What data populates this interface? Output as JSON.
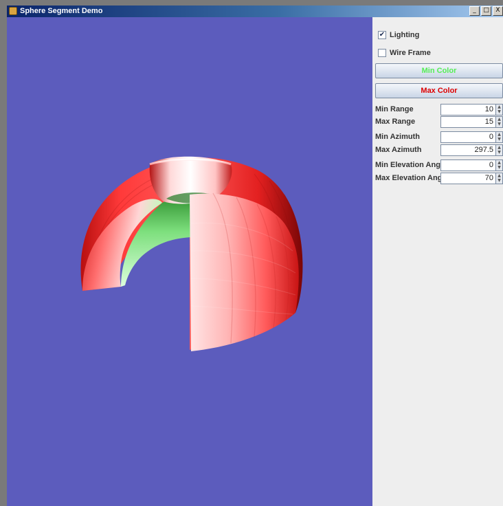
{
  "window": {
    "title": "Sphere Segment Demo"
  },
  "window_buttons": {
    "minimize": "_",
    "maximize": "□",
    "close": "X"
  },
  "controls": {
    "lighting": {
      "label": "Lighting",
      "checked": true,
      "mark": "✔"
    },
    "wireframe": {
      "label": "Wire Frame",
      "checked": false,
      "mark": ""
    },
    "min_color": {
      "label": "Min Color",
      "color": "#55ee55"
    },
    "max_color": {
      "label": "Max Color",
      "color": "#dd0000"
    }
  },
  "fields": [
    {
      "label": "Min Range",
      "value": "10"
    },
    {
      "label": "Max Range",
      "value": "15"
    },
    {
      "label": "Min Azimuth",
      "value": "0"
    },
    {
      "label": "Max Azimuth",
      "value": "297.5"
    },
    {
      "label": "Min Elevation Ang",
      "value": "0"
    },
    {
      "label": "Max Elevation Ang",
      "value": "70"
    }
  ],
  "colors": {
    "viewport_background": "#5c5cbd",
    "segment_max": "#ff4444",
    "segment_min": "#99ff99"
  }
}
